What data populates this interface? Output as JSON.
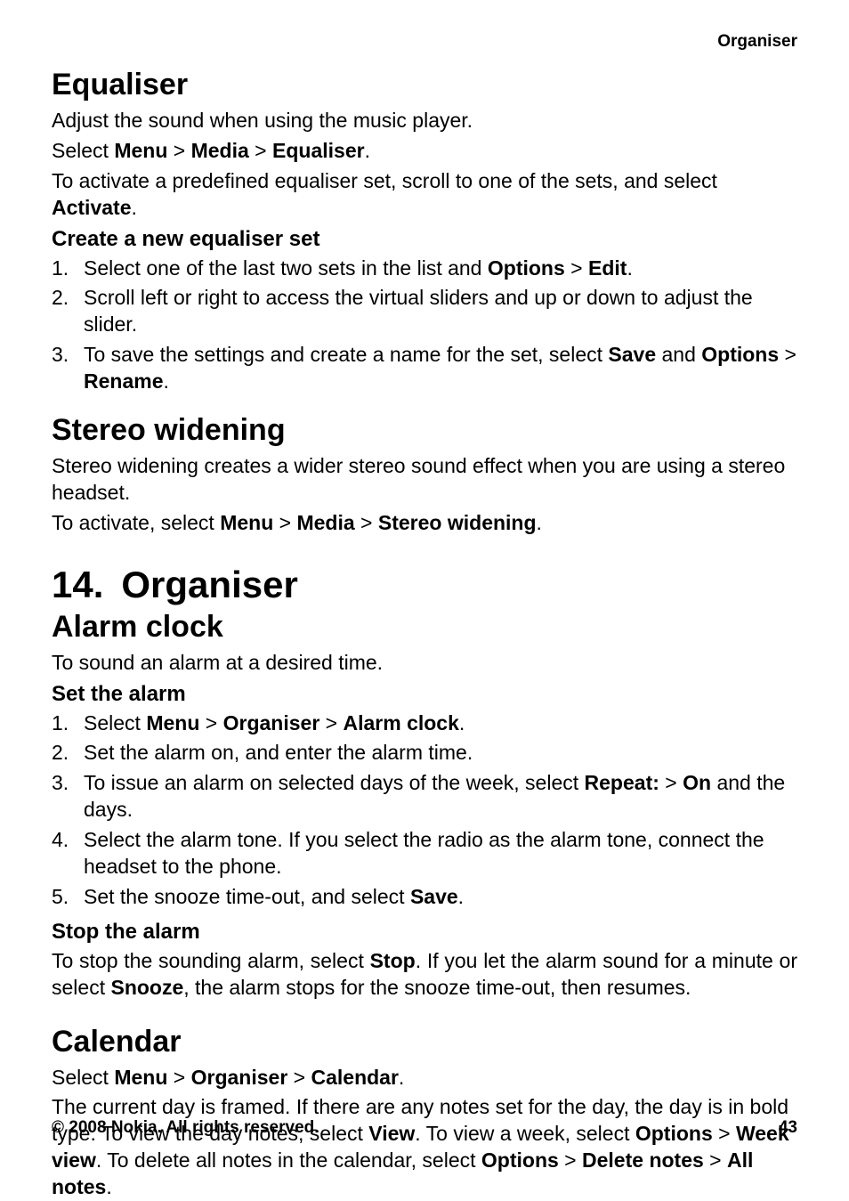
{
  "header": {
    "label": "Organiser"
  },
  "equaliser": {
    "title": "Equaliser",
    "intro": "Adjust the sound when using the music player.",
    "nav_prefix": "Select ",
    "nav_menu": "Menu",
    "nav_media": "Media",
    "nav_equaliser": "Equaliser",
    "nav_dot": ".",
    "activate_prefix": "To activate a predefined equaliser set, scroll to one of the sets, and select ",
    "activate_bold": "Activate",
    "sub_title": "Create a new equaliser set",
    "step1_prefix": "Select one of the last two sets in the list and ",
    "step1_options": "Options",
    "step1_edit": "Edit",
    "step2": "Scroll left or right to access the virtual sliders and up or down to adjust the slider.",
    "step3_prefix": "To save the settings and create a name for the set, select ",
    "step3_save": "Save",
    "step3_and": " and ",
    "step3_options": "Options",
    "step3_rename": "Rename"
  },
  "stereo": {
    "title": "Stereo widening",
    "intro": "Stereo widening creates a wider stereo sound effect when you are using a stereo headset.",
    "nav_prefix": "To activate, select ",
    "nav_menu": "Menu",
    "nav_media": "Media",
    "nav_stereo": "Stereo widening",
    "nav_dot": "."
  },
  "chapter": {
    "num": "14.",
    "title": "Organiser"
  },
  "alarm": {
    "title": "Alarm clock",
    "intro": "To sound an alarm at a desired time.",
    "set_title": "Set the alarm",
    "step1_prefix": "Select ",
    "step1_menu": "Menu",
    "step1_organiser": "Organiser",
    "step1_alarm": "Alarm clock",
    "step2": "Set the alarm on, and enter the alarm time.",
    "step3_prefix": "To issue an alarm on selected days of the week, select ",
    "step3_repeat": "Repeat:",
    "step3_on": "On",
    "step3_suffix": " and the days.",
    "step4": "Select the alarm tone. If you select the radio as the alarm tone, connect the headset to the phone.",
    "step5_prefix": "Set the snooze time-out, and select ",
    "step5_save": "Save",
    "stop_title": "Stop the alarm",
    "stop_p1_prefix": "To stop the sounding alarm, select ",
    "stop_p1_stop": "Stop",
    "stop_p1_mid": ". If you let the alarm sound for a minute or select ",
    "stop_p1_snooze": "Snooze",
    "stop_p1_suffix": ", the alarm stops for the snooze time-out, then resumes."
  },
  "calendar": {
    "title": "Calendar",
    "nav_prefix": "Select ",
    "nav_menu": "Menu",
    "nav_organiser": "Organiser",
    "nav_calendar": "Calendar",
    "nav_dot": ".",
    "p_prefix": "The current day is framed. If there are any notes set for the day, the day is in bold type. To view the day notes, select ",
    "p_view": "View",
    "p_mid1": ". To view a week, select ",
    "p_options1": "Options",
    "p_week": "Week view",
    "p_mid2": ". To delete all notes in the calendar, select ",
    "p_options2": "Options",
    "p_delete": "Delete notes",
    "p_all": "All notes",
    "p_dot": "."
  },
  "footer": {
    "copyright": "© 2008 Nokia. All rights reserved.",
    "page": "43"
  },
  "sep": " > "
}
